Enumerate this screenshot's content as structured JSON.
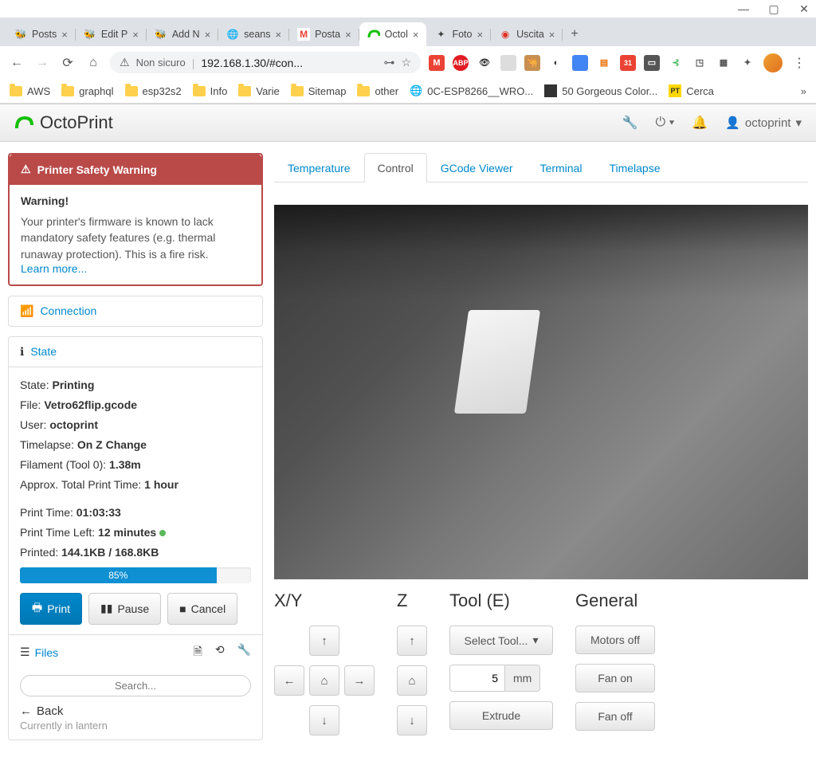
{
  "window": {
    "tabs": [
      {
        "title": "Posts",
        "icon": "🐝"
      },
      {
        "title": "Edit P",
        "icon": "🐝"
      },
      {
        "title": "Add N",
        "icon": "🐝"
      },
      {
        "title": "seans",
        "icon": "🌐"
      },
      {
        "title": "Posta",
        "icon": "M"
      },
      {
        "title": "Octol",
        "icon": "octo",
        "active": true
      },
      {
        "title": "Foto",
        "icon": "✦"
      },
      {
        "title": "Uscita",
        "icon": "🔴"
      }
    ],
    "address_security": "Non sicuro",
    "address": "192.168.1.30/#con...",
    "bookmarks": [
      "AWS",
      "graphql",
      "esp32s2",
      "Info",
      "Varie",
      "Sitemap",
      "other",
      "0C-ESP8266__WRO...",
      "50 Gorgeous Color...",
      "Cerca"
    ]
  },
  "navbar": {
    "brand": "OctoPrint",
    "user": "octoprint"
  },
  "warning": {
    "heading": "Printer Safety Warning",
    "title": "Warning!",
    "text": "Your printer's firmware is known to lack mandatory safety features (e.g. thermal runaway protection). This is a fire risk.",
    "learn_more": "Learn more..."
  },
  "connection": {
    "label": "Connection"
  },
  "state": {
    "heading": "State",
    "state_label": "State:",
    "state_val": "Printing",
    "file_label": "File:",
    "file_val": "Vetro62flip.gcode",
    "user_label": "User:",
    "user_val": "octoprint",
    "timelapse_label": "Timelapse:",
    "timelapse_val": "On Z Change",
    "filament_label": "Filament (Tool 0):",
    "filament_val": "1.38m",
    "approx_label": "Approx. Total Print Time:",
    "approx_val": "1 hour",
    "pt_label": "Print Time:",
    "pt_val": "01:03:33",
    "ptl_label": "Print Time Left:",
    "ptl_val": "12 minutes",
    "printed_label": "Printed:",
    "printed_val": "144.1KB / 168.8KB",
    "progress_pct": "85%",
    "progress_width": "85%"
  },
  "buttons": {
    "print": "Print",
    "pause": "Pause",
    "cancel": "Cancel"
  },
  "files": {
    "heading": "Files",
    "search_placeholder": "Search...",
    "back": "Back",
    "location": "Currently in lantern"
  },
  "tabs": {
    "temperature": "Temperature",
    "control": "Control",
    "gcode": "GCode Viewer",
    "terminal": "Terminal",
    "timelapse": "Timelapse"
  },
  "control": {
    "xy": "X/Y",
    "z": "Z",
    "tool": "Tool (E)",
    "general": "General",
    "select_tool": "Select Tool...",
    "extrude": "Extrude",
    "dist_value": "5",
    "dist_unit": "mm",
    "motors_off": "Motors off",
    "fan_on": "Fan on",
    "fan_off": "Fan off"
  }
}
